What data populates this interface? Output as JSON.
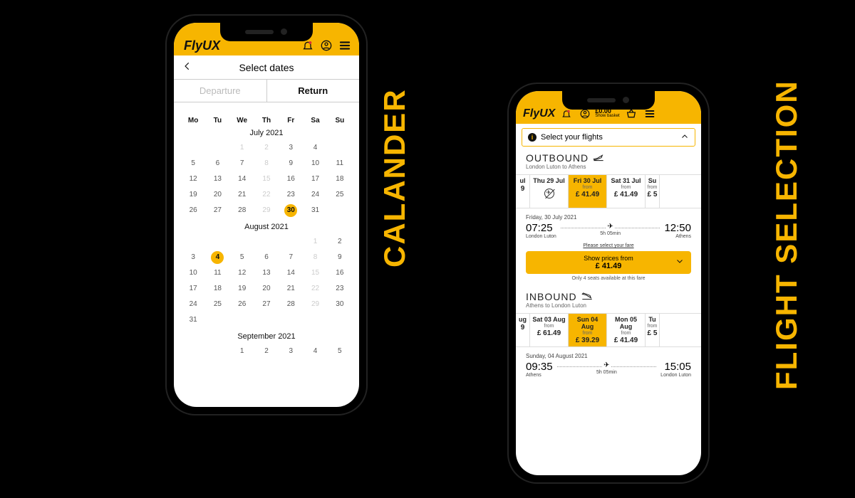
{
  "labels": {
    "calander": "CALANDER",
    "flight": "FLIGHT SELECTION"
  },
  "brand": "FlyUX",
  "calendar": {
    "title": "Select dates",
    "tabs": {
      "departure": "Departure",
      "return": "Return"
    },
    "dow": [
      "Mo",
      "Tu",
      "We",
      "Th",
      "Fr",
      "Sa",
      "Su"
    ],
    "months": {
      "jul": "July 2021",
      "aug": "August 2021",
      "sep": "September 2021"
    },
    "selected_start": 30,
    "selected_end": 4
  },
  "flights": {
    "basket_amount": "£0.00",
    "basket_label": "Show basket",
    "select_bar": "Select your flights",
    "outbound": {
      "title": "OUTBOUND",
      "route": "London Luton to Athens",
      "strip": [
        {
          "date": "ul",
          "from": "",
          "price": "9",
          "edge": true
        },
        {
          "date": "Thu 29 Jul",
          "noflight": true
        },
        {
          "date": "Fri 30 Jul",
          "from": "from",
          "price": "£ 41.49",
          "sel": true
        },
        {
          "date": "Sat 31 Jul",
          "from": "from",
          "price": "£ 41.49"
        },
        {
          "date": "Su",
          "from": "from",
          "price": "£ 5",
          "edge": true
        }
      ],
      "card": {
        "date": "Friday, 30 July 2021",
        "dep_time": "07:25",
        "dep_place": "London Luton",
        "arr_time": "12:50",
        "arr_place": "Athens",
        "duration": "5h 05min"
      },
      "fare_label": "Please select your fare",
      "price_btn_line1": "Show prices from",
      "price_btn_line2": "£ 41.49",
      "seats": "Only 4 seats available at this fare"
    },
    "inbound": {
      "title": "INBOUND",
      "route": "Athens to London Luton",
      "strip": [
        {
          "date": "ug",
          "from": "",
          "price": "9",
          "edge": true
        },
        {
          "date": "Sat 03 Aug",
          "from": "from",
          "price": "£ 61.49"
        },
        {
          "date": "Sun 04 Aug",
          "from": "from",
          "price": "£ 39.29",
          "sel": true
        },
        {
          "date": "Mon 05 Aug",
          "from": "from",
          "price": "£ 41.49"
        },
        {
          "date": "Tu",
          "from": "from",
          "price": "£ 5",
          "edge": true
        }
      ],
      "card": {
        "date": "Sunday, 04 August 2021",
        "dep_time": "09:35",
        "dep_place": "Athens",
        "arr_time": "15:05",
        "arr_place": "London Luton",
        "duration": "5h 05min"
      }
    }
  }
}
